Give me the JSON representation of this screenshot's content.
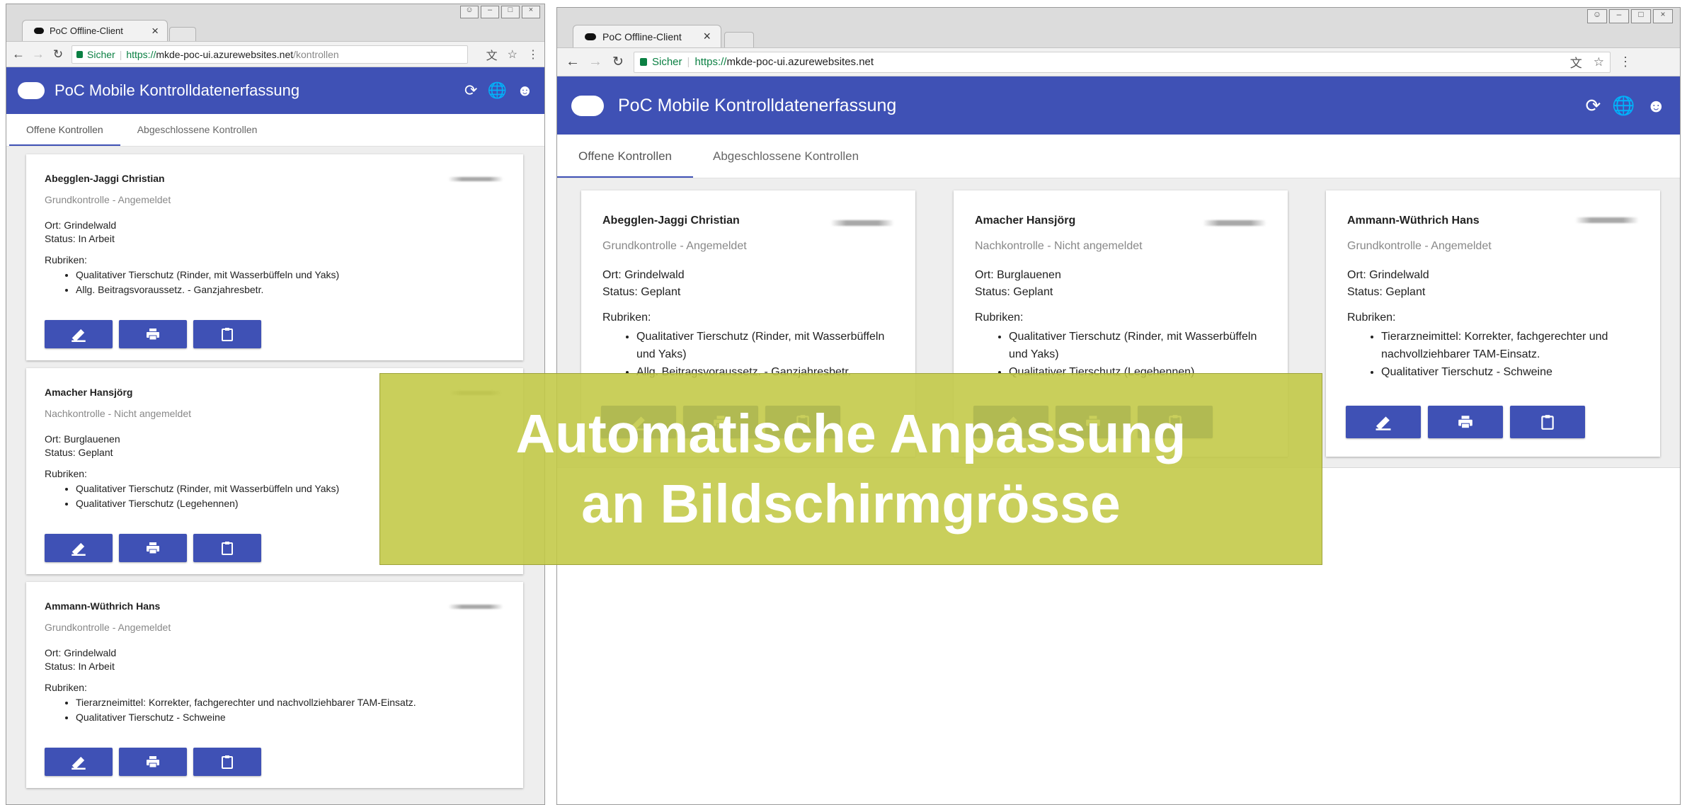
{
  "browser": {
    "tab_title": "PoC Offline-Client",
    "tab_close": "×",
    "secure_label": "Sicher",
    "url_protocol": "https://",
    "url_host": "mkde-poc-ui.azurewebsites.net",
    "url_path_mobile": "/kontrollen",
    "url_path_desktop": "",
    "nav_back_icon": "arrow-left-icon",
    "nav_forward_icon": "arrow-right-icon",
    "nav_reload_icon": "reload-icon",
    "translate_icon": "translate-icon",
    "star_icon": "star-icon",
    "menu_icon": "more-vert-icon",
    "window_controls": [
      "user-icon",
      "minimize-icon",
      "maximize-icon",
      "close-icon"
    ]
  },
  "app": {
    "title": "PoC Mobile Kontrolldatenerfassung",
    "accent": "#3f51b5",
    "header_icons": [
      "sync-icon",
      "globe-icon",
      "account-circle-icon"
    ],
    "tabs": [
      {
        "label": "Offene Kontrollen",
        "active": true
      },
      {
        "label": "Abgeschlossene Kontrollen",
        "active": false
      }
    ]
  },
  "rubriken_label": "Rubriken:",
  "cards_mobile": [
    {
      "name": "Abegglen-Jaggi Christian",
      "sub": "Grundkontrolle - Angemeldet",
      "ort": "Ort: Grindelwald",
      "status": "Status: In Arbeit",
      "items": [
        "Qualitativer Tierschutz (Rinder, mit Wasserbüffeln und Yaks)",
        "Allg. Beitragsvoraussetz. - Ganzjahresbetr."
      ]
    },
    {
      "name": "Amacher Hansjörg",
      "sub": "Nachkontrolle - Nicht angemeldet",
      "ort": "Ort: Burglauenen",
      "status": "Status: Geplant",
      "items": [
        "Qualitativer Tierschutz (Rinder, mit Wasserbüffeln und Yaks)",
        "Qualitativer Tierschutz (Legehennen)"
      ]
    },
    {
      "name": "Ammann-Wüthrich Hans",
      "sub": "Grundkontrolle - Angemeldet",
      "ort": "Ort: Grindelwald",
      "status": "Status: In Arbeit",
      "items": [
        "Tierarzneimittel: Korrekter, fachgerechter und nachvollziehbarer TAM-Einsatz.",
        "Qualitativer Tierschutz - Schweine"
      ]
    }
  ],
  "cards_desktop": [
    {
      "name": "Abegglen-Jaggi Christian",
      "sub": "Grundkontrolle - Angemeldet",
      "ort": "Ort: Grindelwald",
      "status": "Status: Geplant",
      "items": [
        "Qualitativer Tierschutz (Rinder, mit Wasserbüffeln und Yaks)",
        "Allg. Beitragsvoraussetz. - Ganzjahresbetr."
      ]
    },
    {
      "name": "Amacher Hansjörg",
      "sub": "Nachkontrolle - Nicht angemeldet",
      "ort": "Ort: Burglauenen",
      "status": "Status: Geplant",
      "items": [
        "Qualitativer Tierschutz (Rinder, mit Wasserbüffeln und Yaks)",
        "Qualitativer Tierschutz (Legehennen)"
      ]
    },
    {
      "name": "Ammann-Wüthrich Hans",
      "sub": "Grundkontrolle - Angemeldet",
      "ort": "Ort: Grindelwald",
      "status": "Status: Geplant",
      "items": [
        "Tierarzneimittel: Korrekter, fachgerechter und nachvollziehbarer TAM-Einsatz.",
        "Qualitativer Tierschutz - Schweine"
      ]
    }
  ],
  "card_actions": [
    "edit-icon",
    "print-icon",
    "clipboard-icon"
  ],
  "overlay": {
    "line1": "Automatische Anpassung",
    "line2": "an Bildschirmgrösse",
    "color": "#c1c844"
  }
}
